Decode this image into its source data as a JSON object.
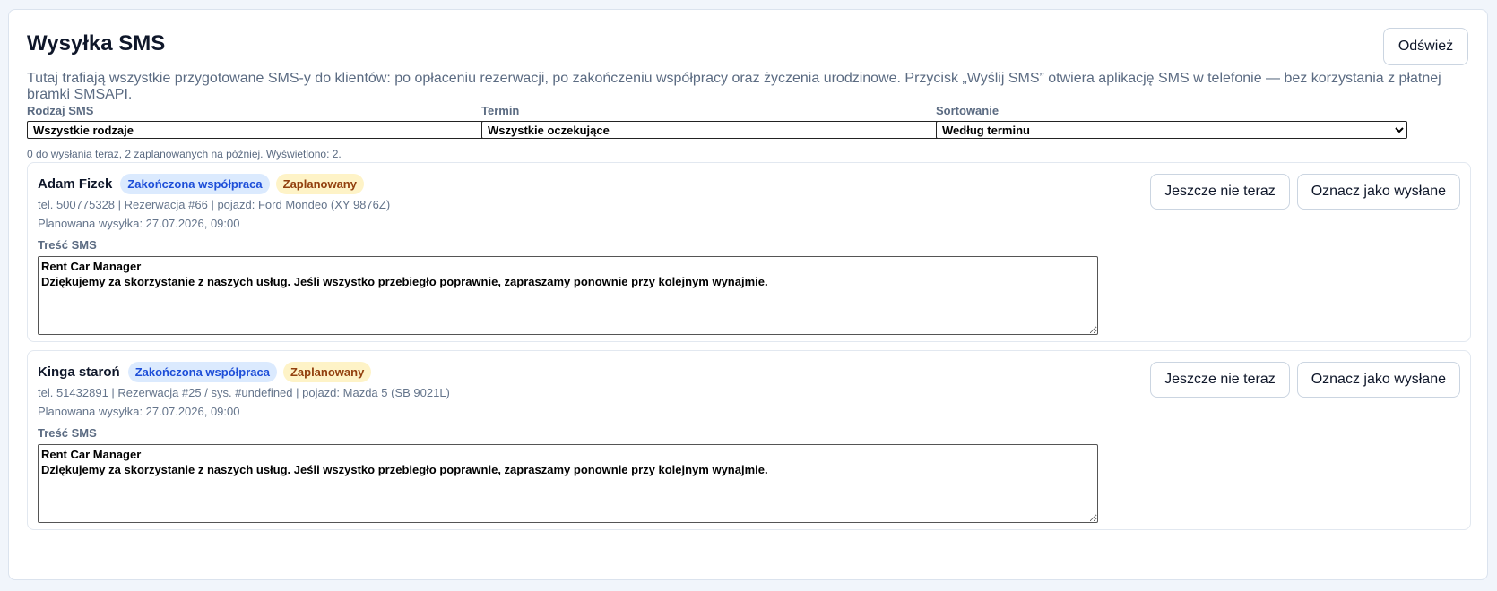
{
  "header": {
    "title": "Wysyłka SMS",
    "refresh_label": "Odśwież",
    "description": "Tutaj trafiają wszystkie przygotowane SMS-y do klientów: po opłaceniu rezerwacji, po zakończeniu współpracy oraz życzenia urodzinowe. Przycisk „Wyślij SMS” otwiera aplikację SMS w telefonie — bez korzystania z płatnej bramki SMSAPI."
  },
  "filters": {
    "type": {
      "label": "Rodzaj SMS",
      "selected": "Wszystkie rodzaje"
    },
    "term": {
      "label": "Termin",
      "selected": "Wszystkie oczekujące"
    },
    "sort": {
      "label": "Sortowanie",
      "selected": "Według terminu"
    }
  },
  "summary": "0 do wysłania teraz, 2 zaplanowanych na później. Wyświetlono: 2.",
  "messages": [
    {
      "client": "Adam Fizek",
      "badge_type": "Zakończona współpraca",
      "badge_status": "Zaplanowany",
      "details": "tel. 500775328 | Rezerwacja #66 | pojazd: Ford Mondeo (XY 9876Z)",
      "scheduled": "Planowana wysyłka: 27.07.2026, 09:00",
      "content_label": "Treść SMS",
      "content": "Rent Car Manager\nDziękujemy za skorzystanie z naszych usług. Jeśli wszystko przebiegło poprawnie, zapraszamy ponownie przy kolejnym wynajmie.",
      "later_label": "Jeszcze nie teraz",
      "mark_sent_label": "Oznacz jako wysłane"
    },
    {
      "client": "Kinga staroń",
      "badge_type": "Zakończona współpraca",
      "badge_status": "Zaplanowany",
      "details": "tel. 51432891 | Rezerwacja #25 / sys. #undefined | pojazd: Mazda 5 (SB 9021L)",
      "scheduled": "Planowana wysyłka: 27.07.2026, 09:00",
      "content_label": "Treść SMS",
      "content": "Rent Car Manager\nDziękujemy za skorzystanie z naszych usług. Jeśli wszystko przebiegło poprawnie, zapraszamy ponownie przy kolejnym wynajmie.",
      "later_label": "Jeszcze nie teraz",
      "mark_sent_label": "Oznacz jako wysłane"
    }
  ],
  "colors": {
    "badge_blue_bg": "#dbeafe",
    "badge_blue_text": "#1d4ed8",
    "badge_yellow_bg": "#fef3c7",
    "badge_yellow_text": "#92400e"
  }
}
